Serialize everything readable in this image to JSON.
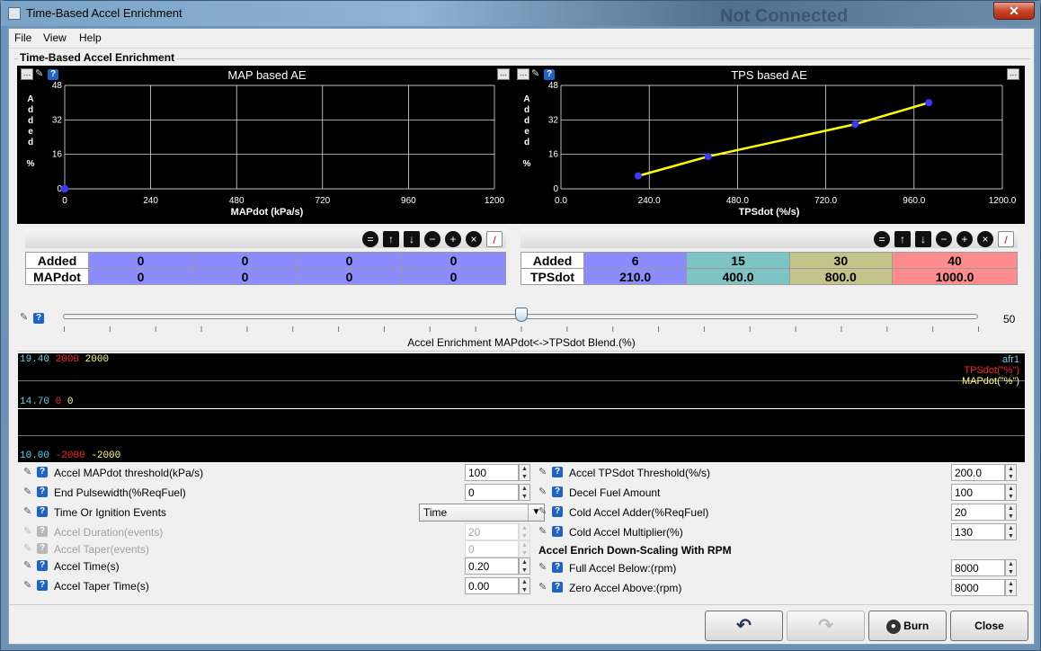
{
  "window": {
    "title": "Time-Based Accel Enrichment",
    "background_ghost_text": "Not Connected",
    "close_glyph": "✕"
  },
  "menu": {
    "file": "File",
    "view": "View",
    "help": "Help"
  },
  "group": {
    "title": "Time-Based Accel Enrichment"
  },
  "chart_data": [
    {
      "type": "line",
      "title": "MAP based AE",
      "xlabel": "MAPdot (kPa/s)",
      "ylabel": "Added %",
      "xlim": [
        0,
        1200
      ],
      "ylim": [
        0,
        48
      ],
      "x_ticks": [
        "0",
        "240",
        "480",
        "720",
        "960",
        "1200"
      ],
      "y_ticks": [
        "0",
        "16",
        "32",
        "48"
      ],
      "grid": true,
      "series": [
        {
          "x": [
            0,
            0,
            0,
            0
          ],
          "y": [
            0,
            0,
            0,
            0
          ],
          "color": "#ffff00"
        }
      ]
    },
    {
      "type": "line",
      "title": "TPS based AE",
      "xlabel": "TPSdot (%/s)",
      "ylabel": "Added %",
      "xlim": [
        0,
        1200
      ],
      "ylim": [
        0,
        48
      ],
      "x_ticks": [
        "0.0",
        "240.0",
        "480.0",
        "720.0",
        "960.0",
        "1200.0"
      ],
      "y_ticks": [
        "0",
        "16",
        "32",
        "48"
      ],
      "grid": true,
      "series": [
        {
          "x": [
            210,
            400,
            800,
            1000
          ],
          "y": [
            6,
            15,
            30,
            40
          ],
          "color": "#ffff00"
        }
      ]
    }
  ],
  "map_table": {
    "row1_header": "Added",
    "row2_header": "MAPdot",
    "added": [
      "0",
      "0",
      "0",
      "0"
    ],
    "mapdot": [
      "0",
      "0",
      "0",
      "0"
    ],
    "cell_color": "#8c8cff"
  },
  "tps_table": {
    "row1_header": "Added",
    "row2_header": "TPSdot",
    "added": [
      "6",
      "15",
      "30",
      "40"
    ],
    "tpsdot": [
      "210.0",
      "400.0",
      "800.0",
      "1000.0"
    ],
    "cell_colors": [
      "#8c8cff",
      "#7fc4c4",
      "#c4c48a",
      "#ff8c8c"
    ]
  },
  "slider": {
    "value": "50",
    "caption": "Accel Enrichment MAPdot<->TPSdot Blend.(%)"
  },
  "logger": {
    "top": {
      "afr": "19.40",
      "tps": "2000",
      "map": "2000"
    },
    "mid": {
      "afr": "14.70",
      "tps": "0",
      "map": "0"
    },
    "bottom": {
      "afr": "10.00",
      "tps": "-2000",
      "map": "-2000"
    },
    "legend": [
      "afr1",
      "TPSdot(\"%\")",
      "MAPdot(\"%\")"
    ]
  },
  "left_fields": [
    {
      "label": "Accel MAPdot threshold(kPa/s)",
      "value": "100"
    },
    {
      "label": "End Pulsewidth(%ReqFuel)",
      "value": "0"
    },
    {
      "label": "Time Or Ignition Events",
      "value": "Time"
    },
    {
      "label": "Accel Duration(events)",
      "value": "20"
    },
    {
      "label": "Accel Taper(events)",
      "value": "0"
    },
    {
      "label": "Accel Time(s)",
      "value": "0.20"
    },
    {
      "label": "Accel Taper Time(s)",
      "value": "0.00"
    }
  ],
  "right_fields": [
    {
      "label": "Accel TPSdot Threshold(%/s)",
      "value": "200.0"
    },
    {
      "label": "Decel Fuel Amount",
      "value": "100"
    },
    {
      "label": "Cold Accel Adder(%ReqFuel)",
      "value": "20"
    },
    {
      "label": "Cold Accel Multiplier(%)",
      "value": "130"
    },
    {
      "label": "Full Accel Below:(rpm)",
      "value": "8000"
    },
    {
      "label": "Zero Accel Above:(rpm)",
      "value": "8000"
    }
  ],
  "rpm_section": "Accel Enrich Down-Scaling With RPM",
  "buttons": {
    "burn": "Burn",
    "close": "Close"
  }
}
